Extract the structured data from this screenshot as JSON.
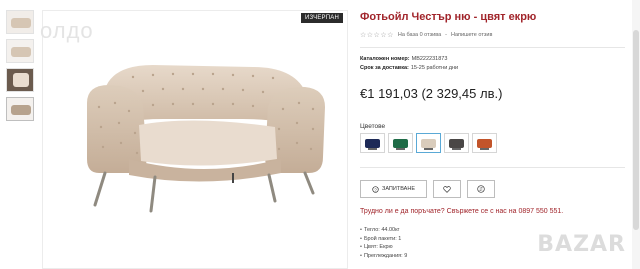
{
  "watermark": "олдо",
  "gallery": {
    "badge": "ИЗЧЕРПАН"
  },
  "product": {
    "title": "Фотьойл Честър ню - цвят екрю",
    "rating_text": "На база 0 отзива",
    "separator": "-",
    "write_review": "Напишете отзив",
    "stars": "☆☆☆☆☆",
    "catalog_label": "Каталожен номер:",
    "catalog_value": "MB222231873",
    "delivery_label": "Срок за доставка:",
    "delivery_value": "15-25 работни дни",
    "price": "€1 191,03 (2 329,45 лв.)",
    "colors_label": "Цветове",
    "colors": [
      "#1d2a57",
      "#1f6b47",
      "#d9ccbc",
      "#4a4746",
      "#c2542a"
    ],
    "request_label": "ЗАПИТВАНЕ",
    "question": "Трудно ли е да поръчате? Свържете се с нас на 0897 550 551.",
    "specs": [
      "Тегло: 44.00кг",
      "Брой пакети: 1",
      "Цвят: Екрю",
      "Преглеждания: 9"
    ]
  },
  "bazar_logo": "BAZAR",
  "accent_color": "#a1252b"
}
